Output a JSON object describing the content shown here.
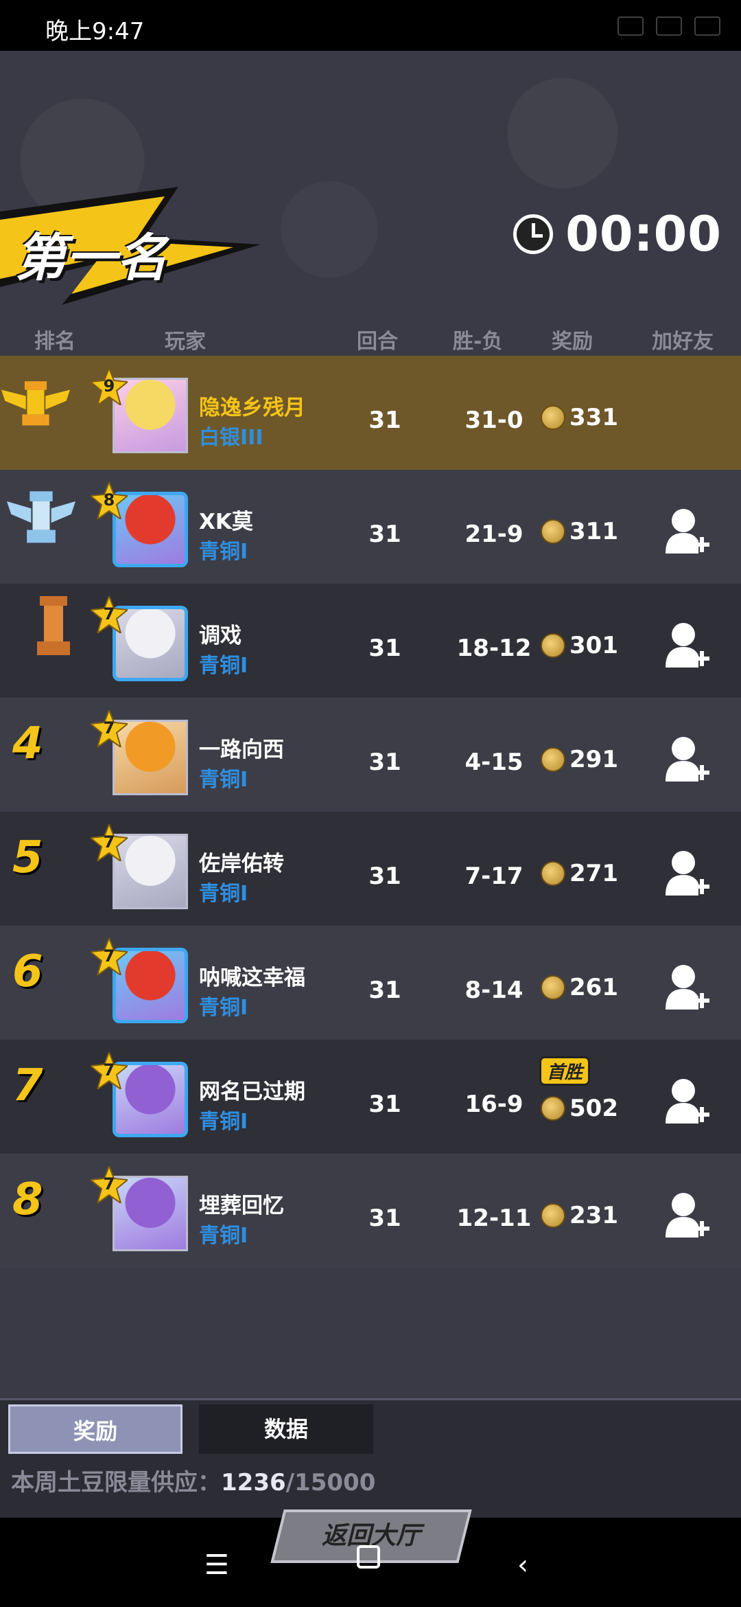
{
  "status_bar": {
    "time": "晚上9:47"
  },
  "banner": {
    "title": "第一名"
  },
  "timer": {
    "value": "00:00"
  },
  "headers": {
    "rank": "排名",
    "player": "玩家",
    "rounds": "回合",
    "win_loss": "胜-负",
    "reward": "奖励",
    "add_friend": "加好友"
  },
  "rows": [
    {
      "rank": "",
      "level": "9",
      "name": "隐逸乡残月",
      "tier": "白银III",
      "rounds": "31",
      "wl": "31-0",
      "reward": "331",
      "badge": ""
    },
    {
      "rank": "",
      "level": "8",
      "name": "XK莫",
      "tier": "青铜I",
      "rounds": "31",
      "wl": "21-9",
      "reward": "311",
      "badge": ""
    },
    {
      "rank": "",
      "level": "7",
      "name": "调戏",
      "tier": "青铜I",
      "rounds": "31",
      "wl": "18-12",
      "reward": "301",
      "badge": ""
    },
    {
      "rank": "4",
      "level": "7",
      "name": "一路向西",
      "tier": "青铜I",
      "rounds": "31",
      "wl": "4-15",
      "reward": "291",
      "badge": ""
    },
    {
      "rank": "5",
      "level": "7",
      "name": "佐岸佑转",
      "tier": "青铜I",
      "rounds": "31",
      "wl": "7-17",
      "reward": "271",
      "badge": ""
    },
    {
      "rank": "6",
      "level": "7",
      "name": "呐喊这幸福",
      "tier": "青铜I",
      "rounds": "31",
      "wl": "8-14",
      "reward": "261",
      "badge": ""
    },
    {
      "rank": "7",
      "level": "7",
      "name": "网名已过期",
      "tier": "青铜I",
      "rounds": "31",
      "wl": "16-9",
      "reward": "502",
      "badge": "首胜"
    },
    {
      "rank": "8",
      "level": "7",
      "name": "埋葬回忆",
      "tier": "青铜I",
      "rounds": "31",
      "wl": "12-11",
      "reward": "231",
      "badge": ""
    }
  ],
  "tabs": {
    "reward": "奖励",
    "data": "数据"
  },
  "supply": {
    "label": "本周土豆限量供应：",
    "current": "1236",
    "total": "/15000"
  },
  "back_button": "返回大厅",
  "colors": {
    "gold": "#f5c418",
    "tier_blue": "#2f8fe0",
    "first_row": "#6e5829"
  }
}
